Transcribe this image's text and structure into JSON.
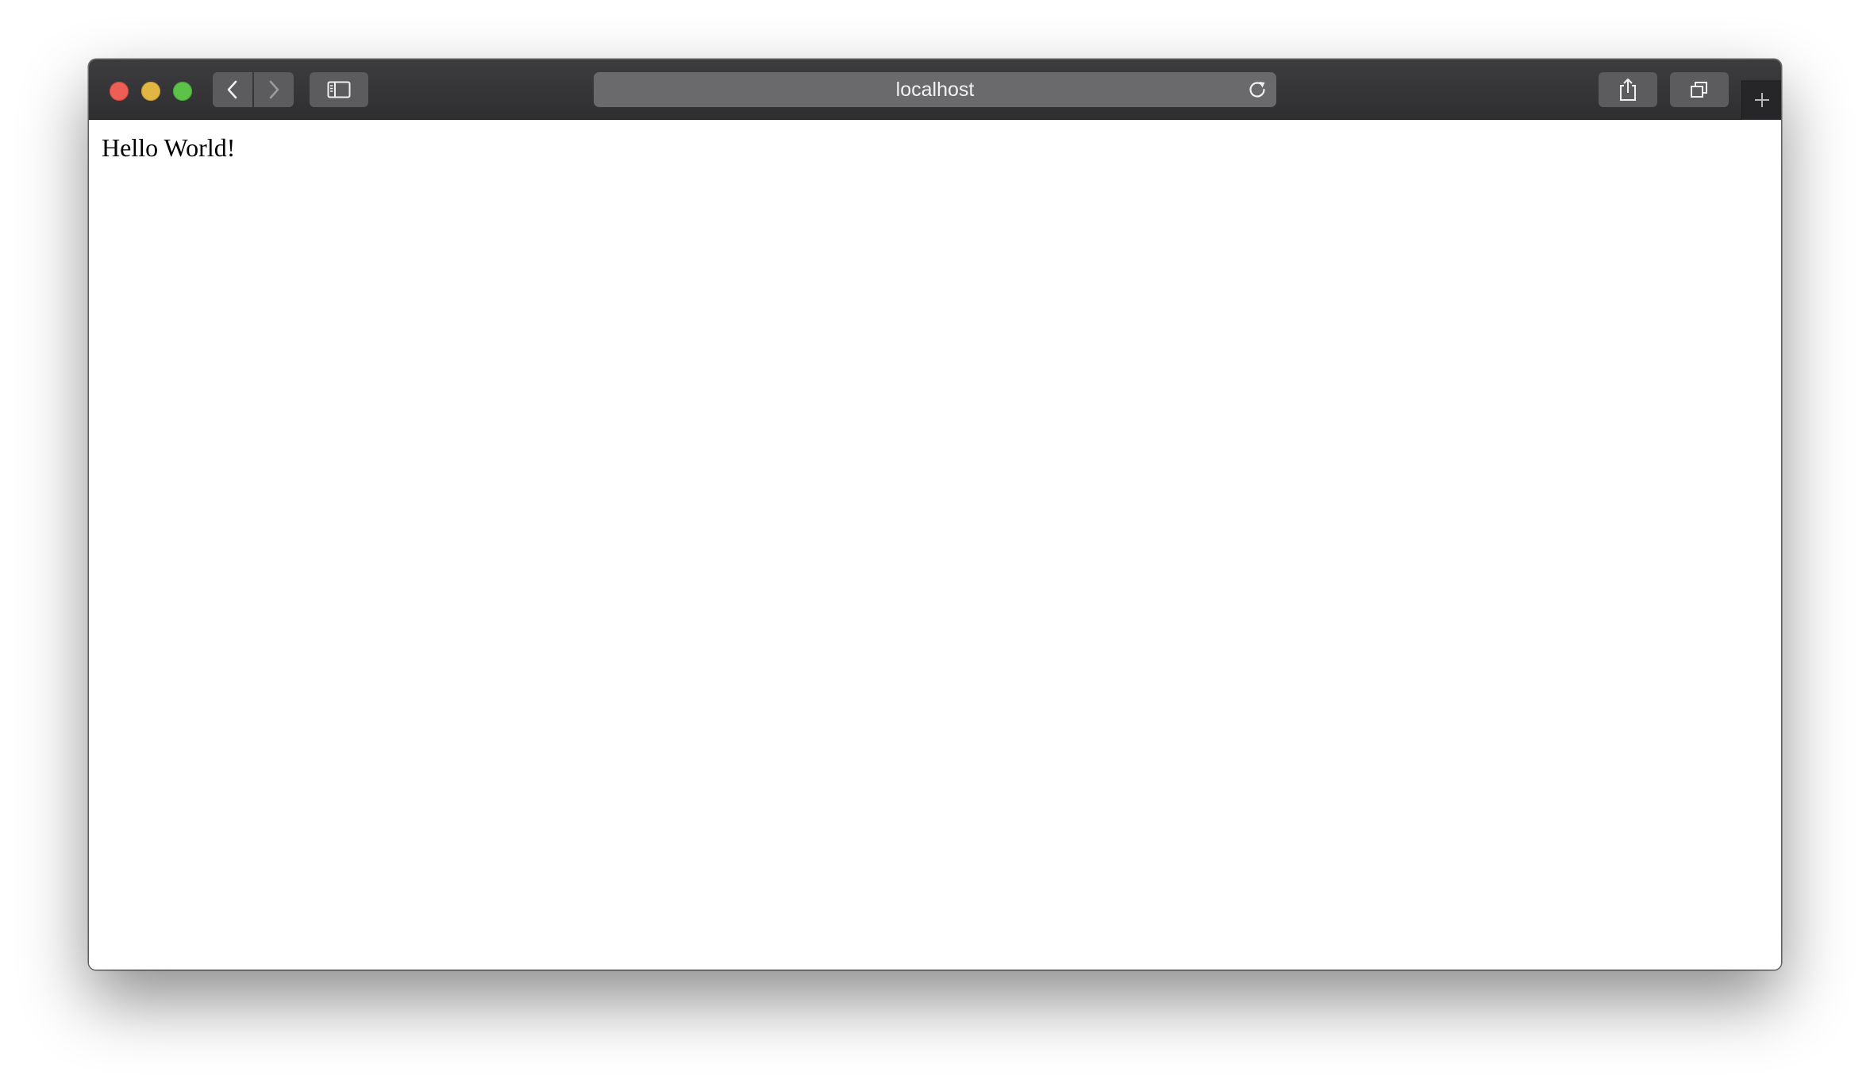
{
  "browser": {
    "address_bar": {
      "url_text": "localhost"
    },
    "icons": {
      "close": "close-window-icon",
      "minimize": "minimize-window-icon",
      "zoom": "zoom-window-icon",
      "back": "chevron-left-icon",
      "forward": "chevron-right-icon",
      "sidebar": "sidebar-icon",
      "reload": "reload-icon",
      "share": "share-icon",
      "tabs": "tab-overview-icon",
      "new_tab": "plus-icon"
    },
    "colors": {
      "toolbar": "#38383a",
      "close": "#ed5e55",
      "minimize": "#e0b742",
      "zoom": "#5ec148"
    }
  },
  "page": {
    "body_text": "Hello World!"
  }
}
